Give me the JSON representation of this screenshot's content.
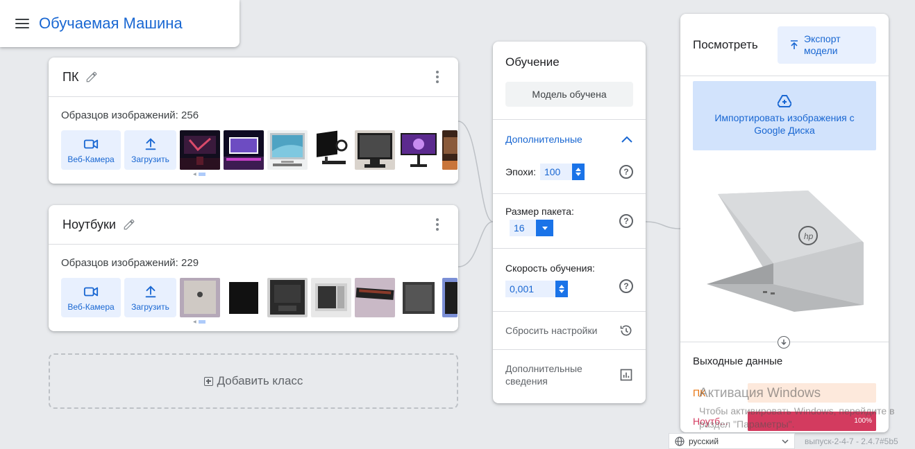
{
  "header": {
    "title": "Обучаемая Машина"
  },
  "classes": [
    {
      "name": "ПК",
      "samples_label": "Образцов изображений: 256",
      "webcam_label": "Веб-Камера",
      "upload_label": "Загрузить"
    },
    {
      "name": "Ноутбуки",
      "samples_label": "Образцов изображений: 229",
      "webcam_label": "Веб-Камера",
      "upload_label": "Загрузить"
    }
  ],
  "add_class_label": "Добавить класс",
  "training": {
    "title": "Обучение",
    "trained_button": "Модель обучена",
    "advanced_label": "Дополнительные",
    "epochs_label": "Эпохи:",
    "epochs_value": "100",
    "batch_label": "Размер пакета:",
    "batch_value": "16",
    "lr_label": "Скорость обучения:",
    "lr_value": "0,001",
    "reset_label": "Сбросить настройки",
    "details_label": "Дополнительные сведения"
  },
  "preview": {
    "title": "Посмотреть",
    "export_label": "Экспорт модели",
    "drive_label": "Импортировать изображения с Google Диска",
    "output_title": "Выходные данные",
    "outputs": [
      {
        "label": "ПК",
        "percent": "",
        "fraction": 0.0,
        "color": "#e8710a",
        "bg": "#fde9dc"
      },
      {
        "label": "Ноутб...",
        "percent": "100%",
        "fraction": 1.0,
        "color": "#d33b5f",
        "bg": "#d33b5f"
      }
    ]
  },
  "windows_notice": {
    "title": "Активация Windows",
    "line": "Чтобы активировать Windows, перейдите в раздел \"Параметры\"."
  },
  "footer": {
    "language": "русский",
    "version": "выпуск-2-4-7 - 2.4.7#5b5"
  }
}
